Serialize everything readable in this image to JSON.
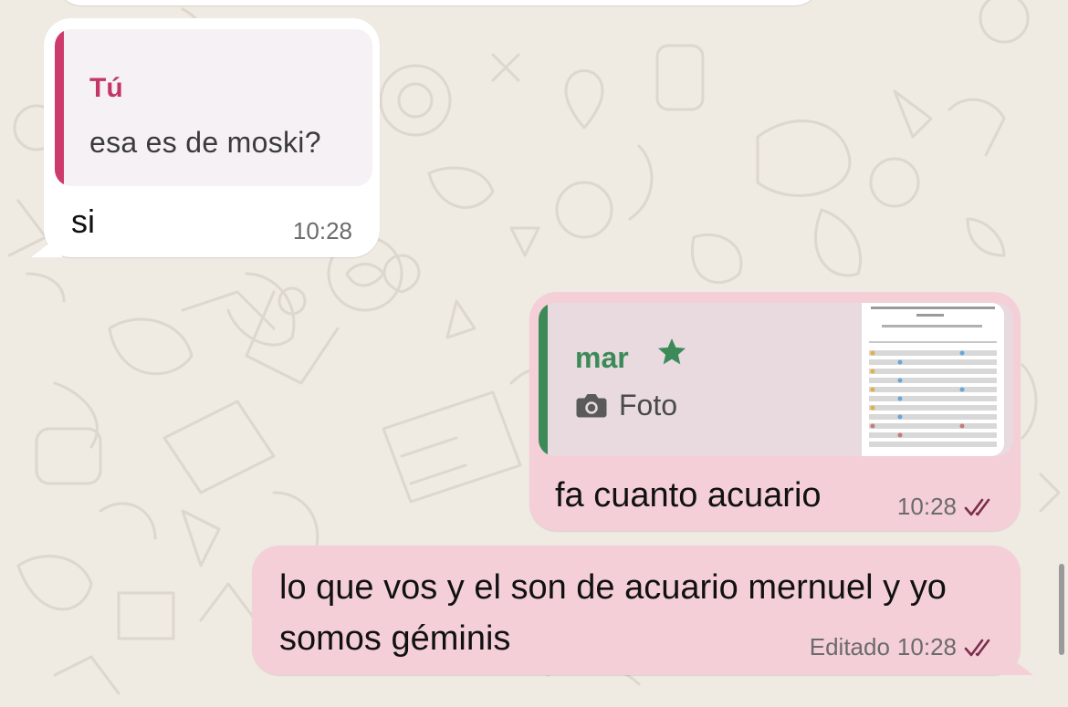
{
  "colors": {
    "chat_background": "#efeae2",
    "incoming_bubble": "#ffffff",
    "outgoing_bubble": "#f4cfd8",
    "quote_incoming_accent": "#cc3b6c",
    "quote_outgoing_accent": "#3c8a58",
    "read_ticks": "#7b2e4a"
  },
  "messages": [
    {
      "direction": "incoming",
      "quote": {
        "author": "Tú",
        "text": "esa es de moski?"
      },
      "text": "si",
      "time": "10:28"
    },
    {
      "direction": "outgoing",
      "quote": {
        "author": "mar",
        "author_icon": "star-icon",
        "type_icon": "camera-icon",
        "type_label": "Foto"
      },
      "text": "fa cuanto acuario",
      "time": "10:28",
      "status_icon": "double-check-icon"
    },
    {
      "direction": "outgoing",
      "text": "lo que vos y el son de acuario mernuel y yo somos géminis",
      "edited_label": "Editado",
      "time": "10:28",
      "status_icon": "double-check-icon"
    }
  ]
}
